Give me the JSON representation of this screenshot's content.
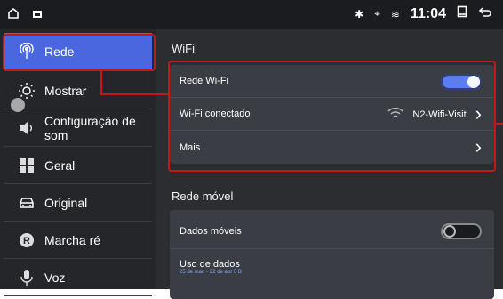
{
  "statusbar": {
    "time": "11:04",
    "home_icon": "home-icon",
    "notification_icon": "notification-icon",
    "bluetooth_icon": "bluetooth-icon",
    "location_icon": "location-icon",
    "wifi_icon": "wifi-icon",
    "window_icon": "window-icon",
    "back_icon": "back-icon"
  },
  "sidebar": {
    "items": [
      {
        "label": "Rede",
        "icon": "wifi-icon",
        "active": true
      },
      {
        "label": "Mostrar",
        "icon": "brightness-icon",
        "active": false
      },
      {
        "label": "Configuração de som",
        "icon": "speaker-icon",
        "active": false
      },
      {
        "label": "Geral",
        "icon": "grid-icon",
        "active": false
      },
      {
        "label": "Original",
        "icon": "car-icon",
        "active": false
      },
      {
        "label": "Marcha ré",
        "icon": "reverse-icon",
        "active": false
      },
      {
        "label": "Voz",
        "icon": "microphone-icon",
        "active": false
      }
    ]
  },
  "wifi": {
    "title": "WiFi",
    "rows": [
      {
        "label": "Rede Wi-Fi",
        "toggle": true
      },
      {
        "label": "Wi-Fi conectado",
        "network": "N2-Wifi-Visit",
        "icon": "wifi-icon",
        "chevron": true
      },
      {
        "label": "Mais",
        "chevron": true
      }
    ]
  },
  "mobile": {
    "title": "Rede móvel",
    "rows": [
      {
        "label": "Dados móveis",
        "toggle": false
      },
      {
        "label": "Uso de dados",
        "sublabel": "25 de mar ~ 22 de abr 0 B"
      }
    ]
  },
  "colors": {
    "accent": "#4a67e0",
    "highlight": "#c4171a",
    "background": "#2b2d31"
  }
}
